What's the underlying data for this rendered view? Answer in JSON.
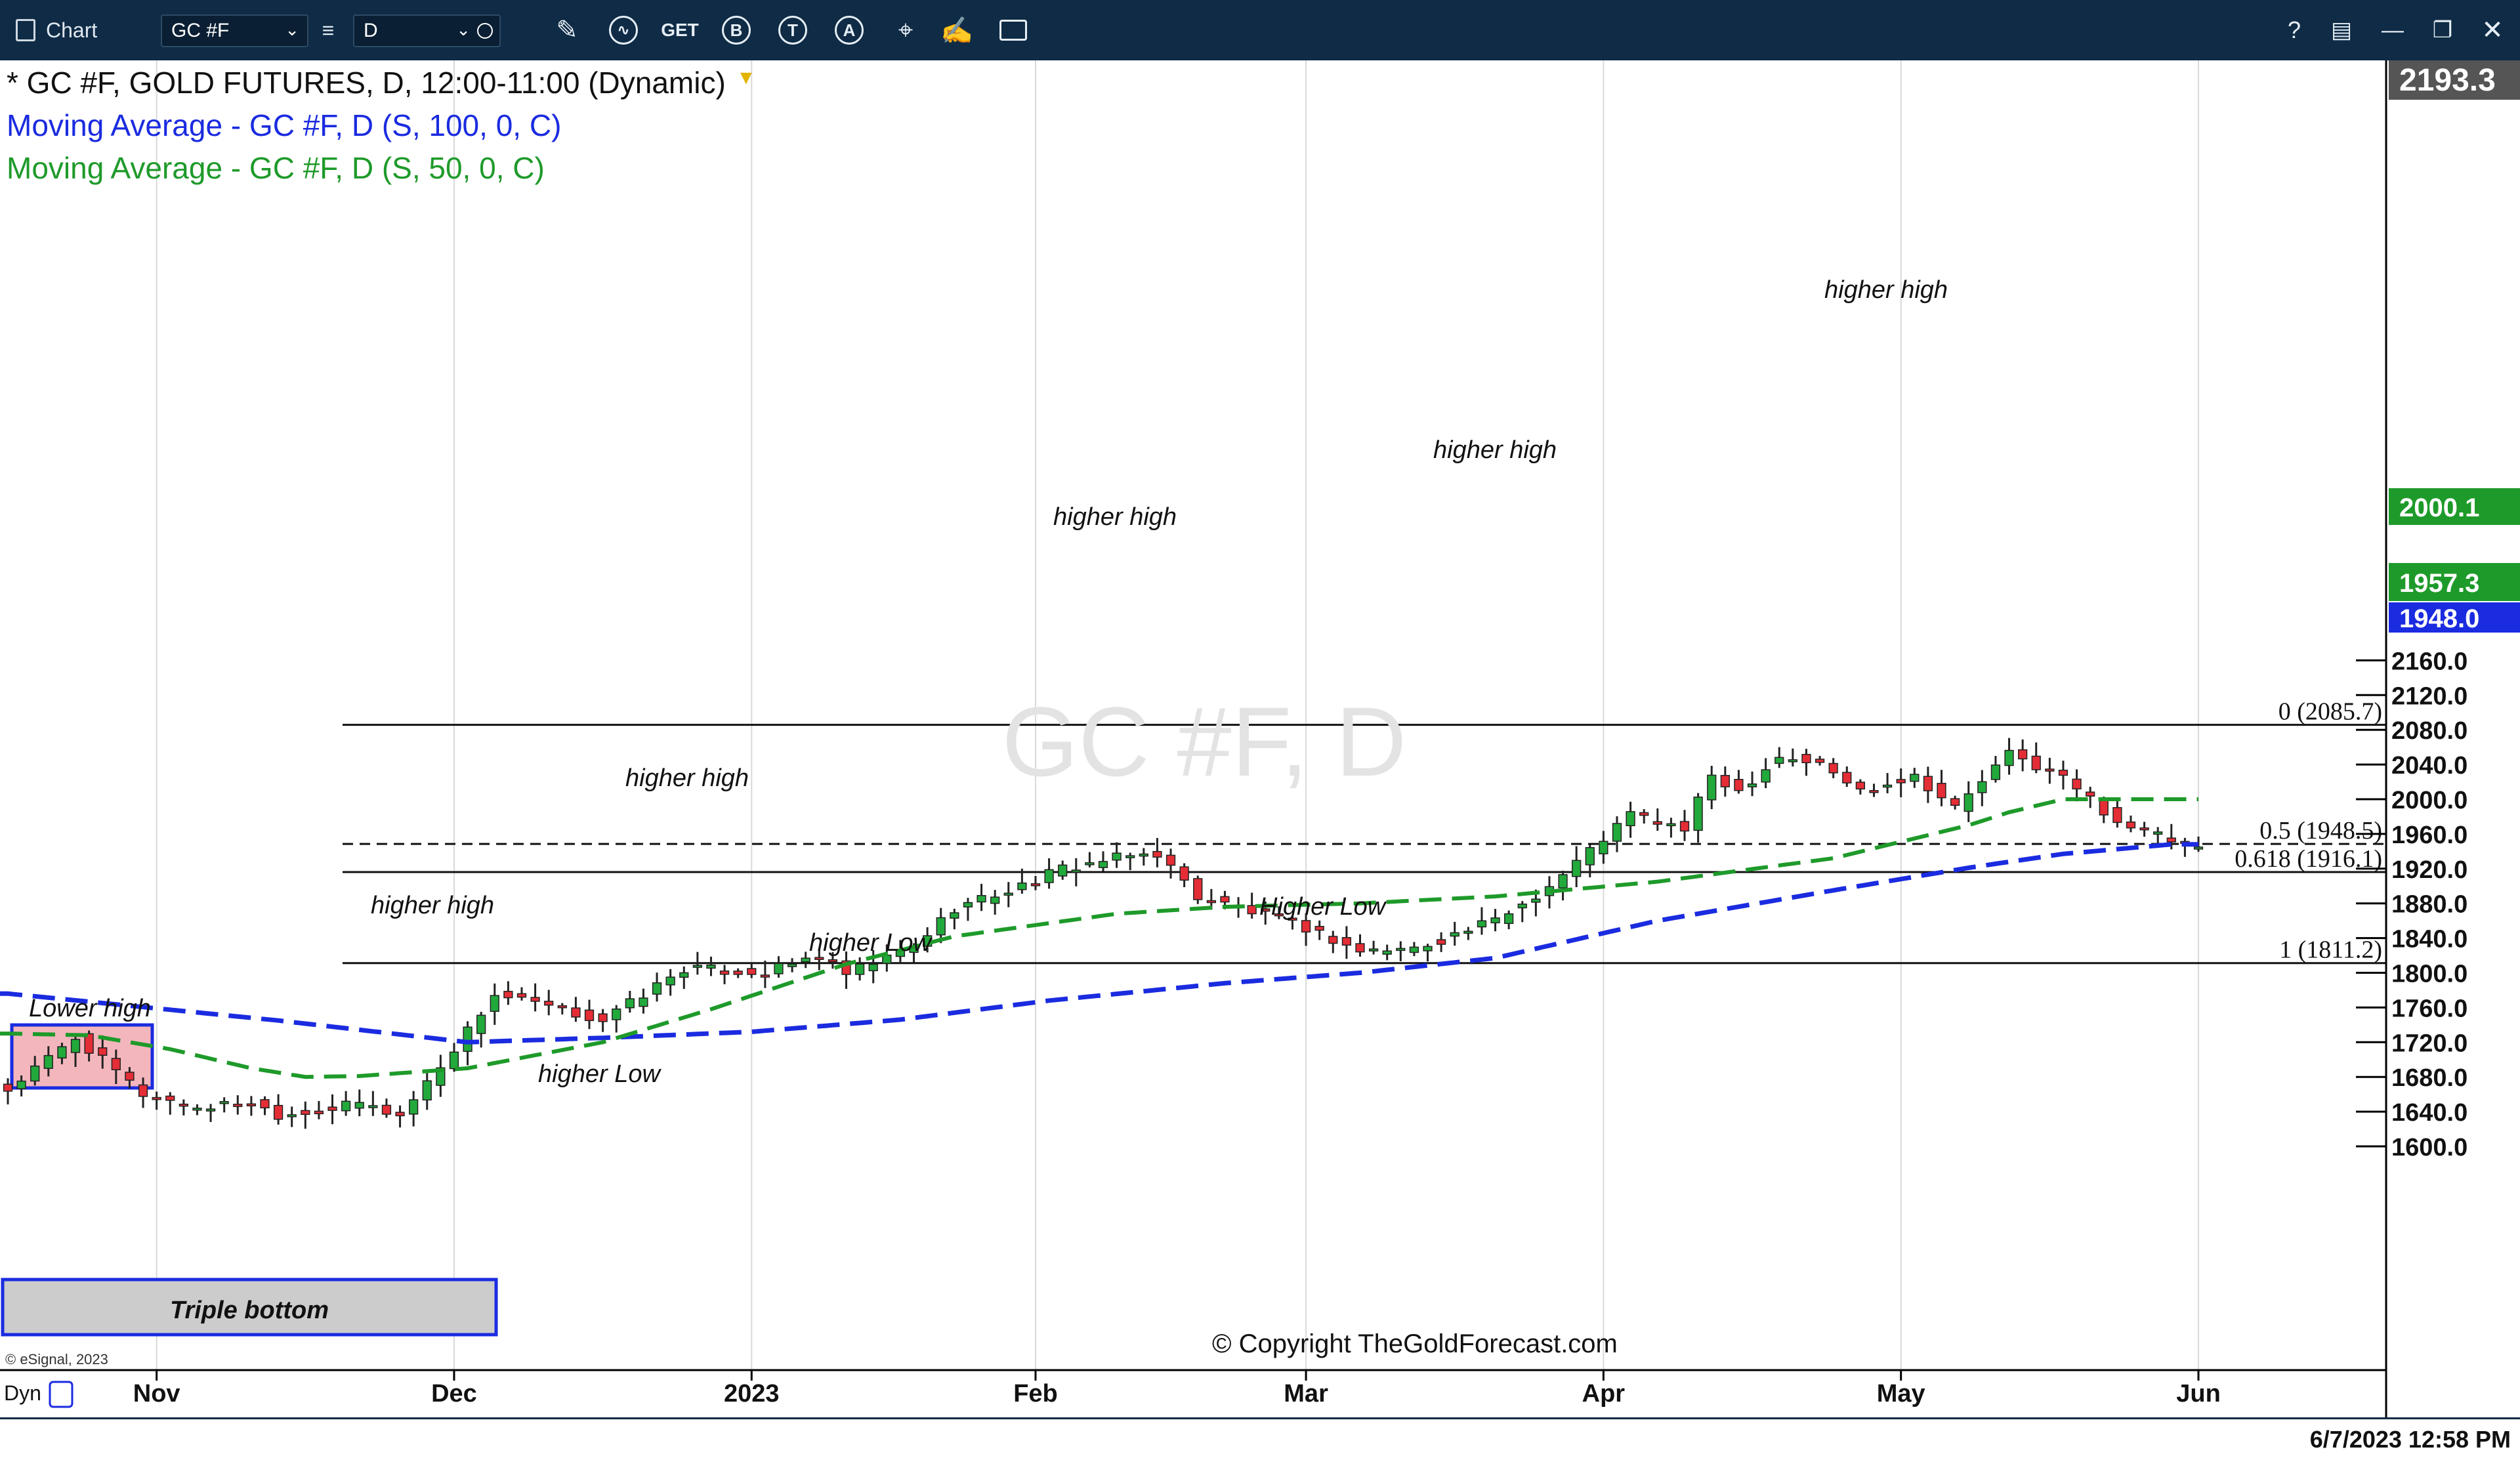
{
  "toolbar": {
    "app_label": "Chart",
    "symbol_value": "GC #F",
    "interval_value": "D",
    "get_label": "GET",
    "b_label": "B",
    "t_label": "T",
    "a_label": "A",
    "help_label": "?"
  },
  "legend": {
    "title": "* GC #F, GOLD FUTURES, D, 12:00-11:00 (Dynamic)",
    "ma100": "Moving Average - GC #F, D (S, 100, 0, C)",
    "ma50": "Moving Average - GC #F, D (S, 50, 0, C)"
  },
  "watermark": "GC #F, D",
  "copyright": "© Copyright TheGoldForecast.com",
  "esignal": "© eSignal, 2023",
  "dyn_label": "Dyn",
  "status_datetime": "6/7/2023 12:58 PM",
  "colors": {
    "toolbar_bg": "#0f2b45",
    "up_candle": "#22a93b",
    "down_candle": "#e52d36",
    "ma100": "#1a2be0",
    "ma50": "#1e9a2a",
    "price_label_bg": "#1e9a2a",
    "ma100_label_bg": "#1a2be0",
    "highlight_lower_high": "#f4b6bd",
    "highlight_triple_bottom": "#cccccc",
    "box_border": "#1a2be0"
  },
  "price_labels": {
    "top": "2193.3",
    "ma50": "2000.1",
    "last": "1957.3",
    "ma100": "1948.0"
  },
  "chart_data": {
    "type": "candlestick",
    "title": "* GC #F, GOLD FUTURES, D, 12:00-11:00 (Dynamic)",
    "ylim": [
      1584,
      2196
    ],
    "y_ticks": [
      "1600.0",
      "1640.0",
      "1680.0",
      "1720.0",
      "1760.0",
      "1800.0",
      "1840.0",
      "1880.0",
      "1920.0",
      "1960.0",
      "2000.0",
      "2040.0",
      "2080.0",
      "2120.0",
      "2160.0"
    ],
    "x_ticks": [
      "Nov",
      "Dec",
      "2023",
      "Feb",
      "Mar",
      "Apr",
      "May",
      "Jun"
    ],
    "fib_levels": [
      {
        "label": "0 (2085.7)",
        "value": 2085.7,
        "style": "solid"
      },
      {
        "label": "0.5 (1948.5)",
        "value": 1948.5,
        "style": "dashed"
      },
      {
        "label": "0.618 (1916.1)",
        "value": 1916.1,
        "style": "solid"
      },
      {
        "label": "1 (1811.2)",
        "value": 1811.2,
        "style": "solid"
      }
    ],
    "annotations": [
      "Lower high",
      "Triple bottom",
      "higher high",
      "higher Low",
      "higher high",
      "higher Low",
      "higher high",
      "Higher Low",
      "higher high",
      "higher high"
    ],
    "ohlc_keyframes": {
      "days": [
        0,
        5,
        10,
        14,
        18,
        20,
        24,
        26,
        29,
        33,
        36,
        44,
        50,
        56,
        60,
        62,
        67,
        70,
        75,
        78,
        82,
        85,
        88,
        92,
        96,
        100,
        104,
        110,
        114,
        118,
        120,
        124,
        126,
        128,
        131,
        134,
        137,
        141,
        144,
        148,
        152,
        154,
        156,
        162
      ],
      "close": [
        1665,
        1725,
        1660,
        1645,
        1650,
        1637,
        1643,
        1650,
        1635,
        1713,
        1775,
        1745,
        1805,
        1800,
        1820,
        1798,
        1830,
        1875,
        1900,
        1920,
        1932,
        1938,
        1888,
        1870,
        1852,
        1825,
        1828,
        1860,
        1900,
        1955,
        1983,
        1965,
        2028,
        2010,
        2050,
        2040,
        2010,
        2028,
        1990,
        2052,
        2025,
        2000,
        1975,
        1940
      ]
    },
    "ma100": {
      "days": [
        0,
        20,
        34,
        44,
        55,
        66,
        77,
        90,
        100,
        110,
        122,
        135,
        145,
        152,
        160
      ],
      "values": [
        1776,
        1745,
        1720,
        1725,
        1732,
        1746,
        1768,
        1788,
        1800,
        1817,
        1860,
        1895,
        1921,
        1937,
        1948
      ]
    },
    "ma50": {
      "days": [
        0,
        6,
        12,
        18,
        22,
        26,
        34,
        44,
        52,
        62,
        70,
        82,
        90,
        100,
        110,
        122,
        135,
        145,
        148,
        152,
        156,
        162
      ],
      "values": [
        1730,
        1728,
        1712,
        1690,
        1680,
        1681,
        1690,
        1720,
        1758,
        1810,
        1842,
        1868,
        1876,
        1880,
        1888,
        1905,
        1932,
        1970,
        1985,
        2000,
        2000,
        2000
      ]
    }
  }
}
